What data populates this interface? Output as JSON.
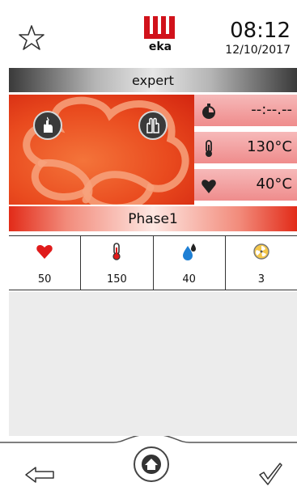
{
  "header": {
    "brand": "eka",
    "time": "08:12",
    "date": "12/10/2017"
  },
  "mode": {
    "label": "expert"
  },
  "program": {
    "timer": "--:--.--",
    "chamber_temp": "130°C",
    "core_temp": "40°C"
  },
  "phase": {
    "label": "Phase1",
    "cells": [
      {
        "icon": "heart-icon",
        "value": "50"
      },
      {
        "icon": "thermometer-icon",
        "value": "150"
      },
      {
        "icon": "humidity-drop-icon",
        "value": "40"
      },
      {
        "icon": "fan-icon",
        "value": "3"
      }
    ]
  },
  "colors": {
    "accent_red": "#e22b18",
    "stat_pink": "#f2a3a3",
    "humidity_blue": "#1e7fd4"
  }
}
